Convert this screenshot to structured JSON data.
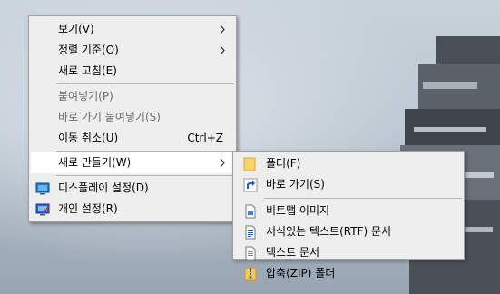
{
  "context_menu": {
    "items": [
      {
        "label": "보기(V)"
      },
      {
        "label": "정렬 기준(O)"
      },
      {
        "label": "새로 고침(E)"
      },
      {
        "label": "붙여넣기(P)"
      },
      {
        "label": "바로 가기 붙여넣기(S)"
      },
      {
        "label": "이동 취소(U)",
        "shortcut": "Ctrl+Z"
      },
      {
        "label": "새로 만들기(W)"
      },
      {
        "label": "디스플레이 설정(D)",
        "icon": "display-icon"
      },
      {
        "label": "개인 설정(R)",
        "icon": "personalize-icon"
      }
    ]
  },
  "new_submenu": {
    "items": [
      {
        "label": "폴더(F)",
        "icon": "folder-icon"
      },
      {
        "label": "바로 가기(S)",
        "icon": "shortcut-icon"
      },
      {
        "label": "비트맵 이미지",
        "icon": "bitmap-icon"
      },
      {
        "label": "서식있는 텍스트(RTF) 문서",
        "icon": "rtf-document-icon"
      },
      {
        "label": "텍스트 문서",
        "icon": "text-document-icon"
      },
      {
        "label": "압축(ZIP) 폴더",
        "icon": "zip-folder-icon"
      }
    ]
  },
  "colors": {
    "menu_bg": "#eeeeee",
    "hover_bg": "#ffffff",
    "disabled_text": "#6d6d6d",
    "separator": "#b5b5b5"
  }
}
